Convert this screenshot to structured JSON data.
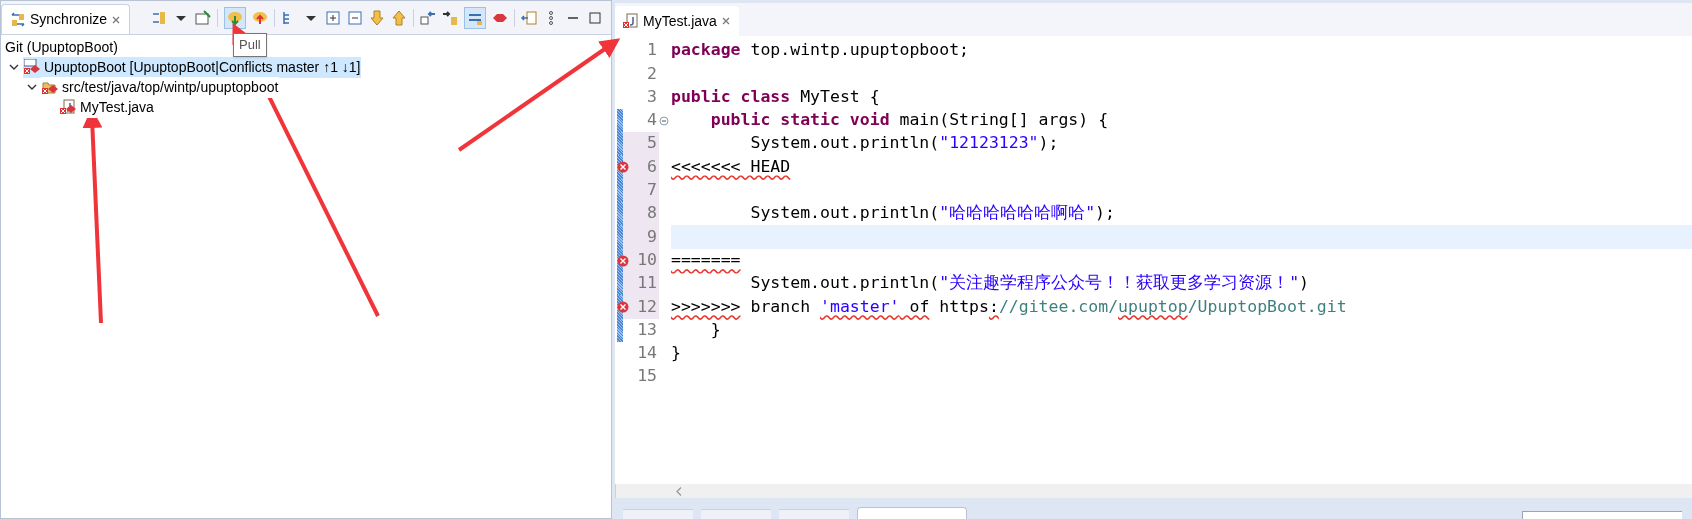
{
  "sync_view": {
    "tab": {
      "title": "Synchronize",
      "selected": true
    },
    "tooltip": "Pull",
    "header": "Git (UpuptopBoot)",
    "tree": [
      {
        "label": "UpuptopBoot [UpuptopBoot|Conflicts master ↑1 ↓1]",
        "kind": "project",
        "expanded": true,
        "selected": true,
        "children": [
          {
            "label": "src/test/java/top/wintp/upuptopboot",
            "kind": "package",
            "expanded": true,
            "selected": false,
            "children": [
              {
                "label": "MyTest.java",
                "kind": "file",
                "selected": false
              }
            ]
          }
        ]
      }
    ]
  },
  "editor": {
    "tab": {
      "title": "MyTest.java",
      "selected": true
    },
    "lines": [
      {
        "number": "1",
        "error": false,
        "bar": false,
        "shaded": false,
        "current": false,
        "fold": false,
        "tokens": [
          {
            "text": "package",
            "kind": "keyword"
          },
          {
            "text": " top.wintp.upuptopboot;",
            "kind": "plain"
          }
        ]
      },
      {
        "number": "2",
        "error": false,
        "bar": false,
        "shaded": false,
        "current": false,
        "fold": false
      },
      {
        "number": "3",
        "error": false,
        "bar": false,
        "shaded": false,
        "current": false,
        "fold": false,
        "tokens": [
          {
            "text": "public",
            "kind": "keyword"
          },
          {
            "text": " class",
            "kind": "keyword"
          },
          {
            "text": " MyTest {",
            "kind": "plain"
          }
        ]
      },
      {
        "number": "4",
        "error": false,
        "bar": true,
        "shaded": false,
        "current": false,
        "fold": true,
        "tokens": [
          {
            "text": "    public",
            "kind": "keyword"
          },
          {
            "text": " static",
            "kind": "keyword"
          },
          {
            "text": " void",
            "kind": "keyword"
          },
          {
            "text": " main(String[] args) {",
            "kind": "plain"
          }
        ]
      },
      {
        "number": "5",
        "error": false,
        "bar": true,
        "shaded": true,
        "current": false,
        "fold": false,
        "tokens": [
          {
            "text": "        System.out.println(",
            "kind": "plain"
          },
          {
            "text": "\"12123123\"",
            "kind": "string"
          },
          {
            "text": ");",
            "kind": "plain"
          }
        ]
      },
      {
        "number": "6",
        "error": true,
        "bar": true,
        "shaded": true,
        "current": false,
        "fold": false,
        "tokens": [
          {
            "text": "<<<<<<< HEAD",
            "kind": "plain",
            "squiggle": true
          }
        ]
      },
      {
        "number": "7",
        "error": false,
        "bar": true,
        "shaded": true,
        "current": false,
        "fold": false
      },
      {
        "number": "8",
        "error": false,
        "bar": true,
        "shaded": true,
        "current": false,
        "fold": false,
        "tokens": [
          {
            "text": "        System.out.println(",
            "kind": "plain"
          },
          {
            "text": "\"哈哈哈哈哈哈啊哈\"",
            "kind": "string"
          },
          {
            "text": ");",
            "kind": "plain"
          }
        ]
      },
      {
        "number": "9",
        "error": false,
        "bar": true,
        "shaded": true,
        "current": true,
        "fold": false
      },
      {
        "number": "10",
        "error": true,
        "bar": true,
        "shaded": true,
        "current": false,
        "fold": false,
        "tokens": [
          {
            "text": "=======",
            "kind": "plain",
            "squiggle": true
          }
        ]
      },
      {
        "number": "11",
        "error": false,
        "bar": true,
        "shaded": true,
        "current": false,
        "fold": false,
        "tokens": [
          {
            "text": "        System.out.println(",
            "kind": "plain"
          },
          {
            "text": "\"关注趣学程序公众号！！获取更多学习资源！\"",
            "kind": "string"
          },
          {
            "text": ")",
            "kind": "plain"
          }
        ]
      },
      {
        "number": "12",
        "error": true,
        "bar": true,
        "shaded": true,
        "current": false,
        "fold": false,
        "tokens": [
          {
            "text": ">>>>>>>",
            "kind": "plain",
            "squiggle": true
          },
          {
            "text": " branch ",
            "kind": "plain"
          },
          {
            "text": "'master'",
            "kind": "string",
            "squiggle": true
          },
          {
            "text": " of",
            "kind": "plain",
            "squiggle": true
          },
          {
            "text": " https",
            "kind": "plain"
          },
          {
            "text": ":",
            "kind": "plain",
            "squiggle": true
          },
          {
            "text": "//gitee.com/",
            "kind": "comment"
          },
          {
            "text": "upuptop",
            "kind": "comment",
            "squiggle": true
          },
          {
            "text": "/UpuptopBoot.git",
            "kind": "comment"
          }
        ]
      },
      {
        "number": "13",
        "error": false,
        "bar": true,
        "shaded": false,
        "current": false,
        "fold": false,
        "tokens": [
          {
            "text": "    }",
            "kind": "plain"
          }
        ]
      },
      {
        "number": "14",
        "error": false,
        "bar": false,
        "shaded": false,
        "current": false,
        "fold": false,
        "tokens": [
          {
            "text": "}",
            "kind": "plain"
          }
        ]
      },
      {
        "number": "15",
        "error": false,
        "bar": false,
        "shaded": false,
        "current": false,
        "fold": false
      }
    ]
  },
  "bottom_tabs": [
    {
      "selected": false
    },
    {
      "selected": false
    },
    {
      "selected": false
    },
    {
      "selected": true
    }
  ]
}
